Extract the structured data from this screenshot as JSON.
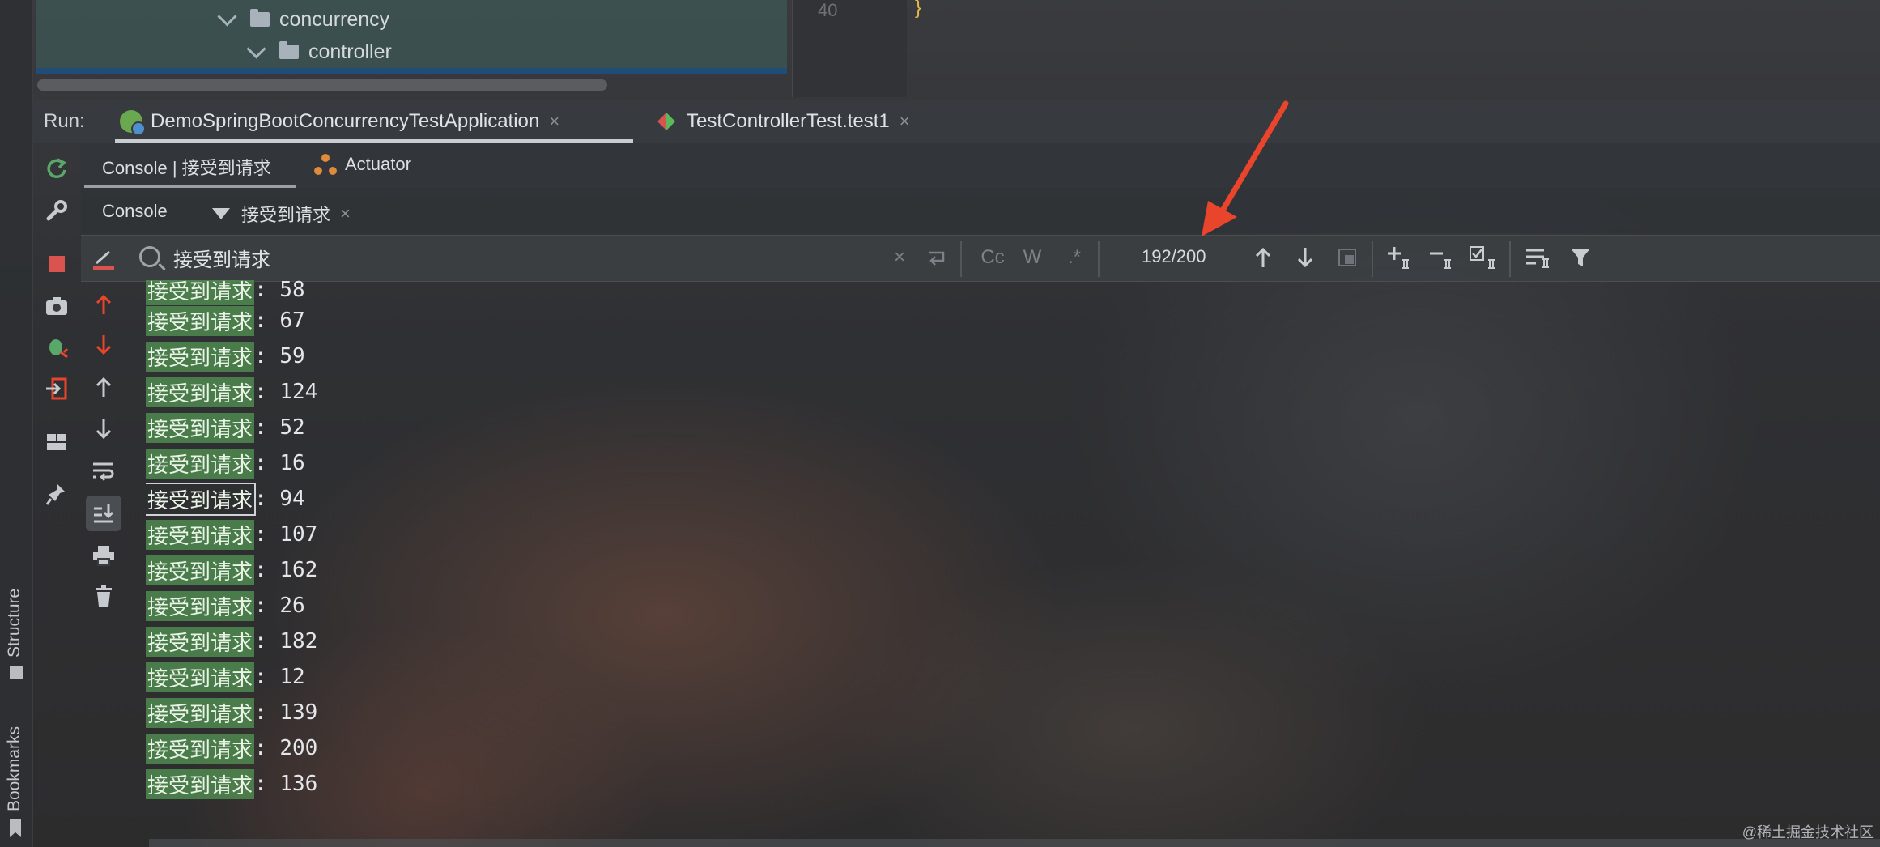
{
  "project_tree": {
    "folder1": "concurrency",
    "folder2": "controller",
    "gutter_line": "40",
    "brace": "}"
  },
  "side_stripe": {
    "structure": "Structure",
    "bookmarks": "Bookmarks"
  },
  "run": {
    "label": "Run:",
    "tabs": [
      {
        "label": "DemoSpringBootConcurrencyTestApplication",
        "close": "×"
      },
      {
        "label": "TestControllerTest.test1",
        "close": "×"
      }
    ]
  },
  "subtabs": {
    "console_tab": "Console | 接受到请求",
    "actuator_tab": "Actuator",
    "console": "Console",
    "filter_tab": "接受到请求",
    "filter_close": "×"
  },
  "search": {
    "value": "接受到请求",
    "clear": "×",
    "match_case": "Cc",
    "words": "W",
    "regex": ".*",
    "count": "192/200"
  },
  "console": {
    "partial_line": {
      "keyword": "接受到请求",
      "sep": ": ",
      "num": "58"
    },
    "lines": [
      {
        "keyword": "接受到请求",
        "sep": ": ",
        "num": "67"
      },
      {
        "keyword": "接受到请求",
        "sep": ": ",
        "num": "59"
      },
      {
        "keyword": "接受到请求",
        "sep": ": ",
        "num": "124"
      },
      {
        "keyword": "接受到请求",
        "sep": ": ",
        "num": "52"
      },
      {
        "keyword": "接受到请求",
        "sep": ": ",
        "num": "16"
      },
      {
        "keyword": "接受到请求",
        "sep": ": ",
        "num": "94"
      },
      {
        "keyword": "接受到请求",
        "sep": ": ",
        "num": "107"
      },
      {
        "keyword": "接受到请求",
        "sep": ": ",
        "num": "162"
      },
      {
        "keyword": "接受到请求",
        "sep": ": ",
        "num": "26"
      },
      {
        "keyword": "接受到请求",
        "sep": ": ",
        "num": "182"
      },
      {
        "keyword": "接受到请求",
        "sep": ": ",
        "num": "12"
      },
      {
        "keyword": "接受到请求",
        "sep": ": ",
        "num": "139"
      },
      {
        "keyword": "接受到请求",
        "sep": ": ",
        "num": "200"
      },
      {
        "keyword": "接受到请求",
        "sep": ": ",
        "num": "136"
      }
    ]
  },
  "watermark": "@稀土掘金技术社区",
  "colors": {
    "match_highlight": "#549654",
    "arrow": "#e8452c",
    "stop_button": "#d9534f"
  }
}
